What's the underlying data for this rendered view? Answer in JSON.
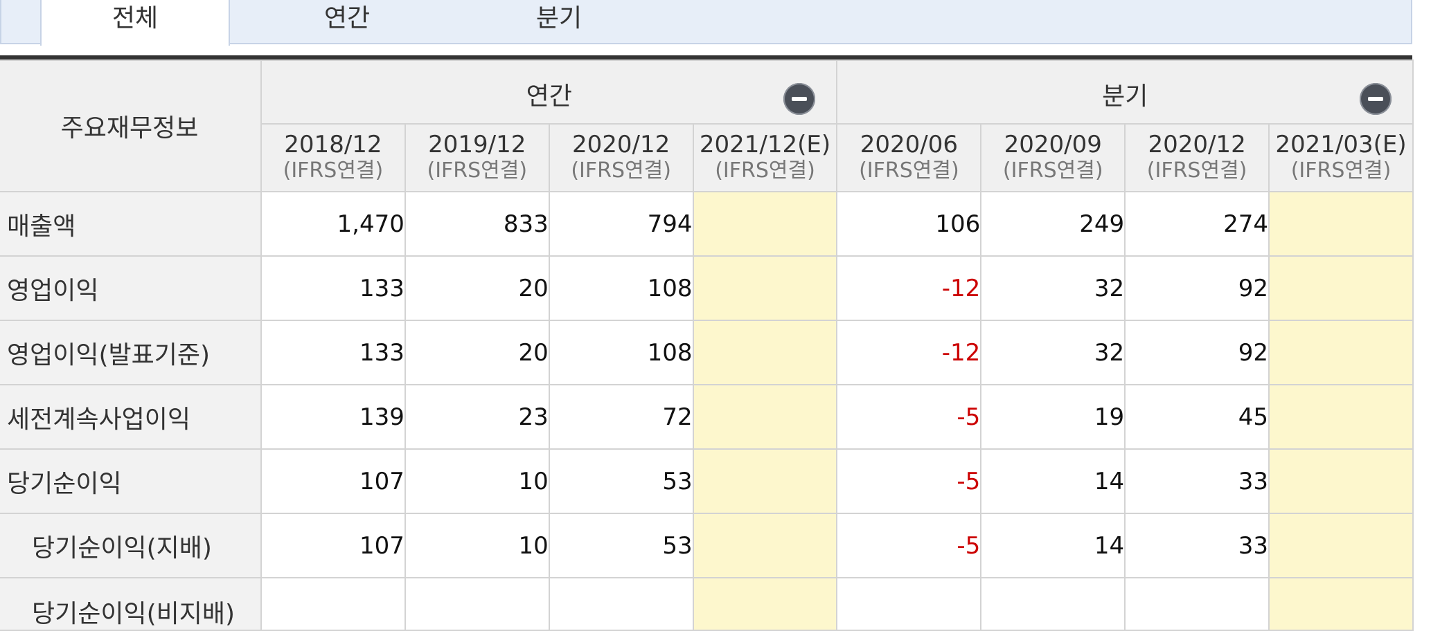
{
  "tabs": {
    "all": "전체",
    "annual": "연간",
    "quarter": "분기"
  },
  "table": {
    "main_header": "주요재무정보",
    "group_annual": "연간",
    "group_quarter": "분기",
    "periods": [
      {
        "date": "2018/12",
        "basis": "(IFRS연결)"
      },
      {
        "date": "2019/12",
        "basis": "(IFRS연결)"
      },
      {
        "date": "2020/12",
        "basis": "(IFRS연결)"
      },
      {
        "date": "2021/12(E)",
        "basis": "(IFRS연결)"
      },
      {
        "date": "2020/06",
        "basis": "(IFRS연결)"
      },
      {
        "date": "2020/09",
        "basis": "(IFRS연결)"
      },
      {
        "date": "2020/12",
        "basis": "(IFRS연결)"
      },
      {
        "date": "2021/03(E)",
        "basis": "(IFRS연결)"
      }
    ],
    "rows": [
      {
        "label": "매출액",
        "values": [
          "1,470",
          "833",
          "794",
          "",
          "106",
          "249",
          "274",
          ""
        ]
      },
      {
        "label": "영업이익",
        "values": [
          "133",
          "20",
          "108",
          "",
          "-12",
          "32",
          "92",
          ""
        ]
      },
      {
        "label": "영업이익(발표기준)",
        "values": [
          "133",
          "20",
          "108",
          "",
          "-12",
          "32",
          "92",
          ""
        ]
      },
      {
        "label": "세전계속사업이익",
        "values": [
          "139",
          "23",
          "72",
          "",
          "-5",
          "19",
          "45",
          ""
        ]
      },
      {
        "label": "당기순이익",
        "values": [
          "107",
          "10",
          "53",
          "",
          "-5",
          "14",
          "33",
          ""
        ]
      },
      {
        "label": "당기순이익(지배)",
        "values": [
          "107",
          "10",
          "53",
          "",
          "-5",
          "14",
          "33",
          ""
        ]
      },
      {
        "label": "당기순이익(비지배)",
        "values": [
          "",
          "",
          "",
          "",
          "",
          "",
          "",
          ""
        ]
      }
    ]
  },
  "colors": {
    "negative": "#cc0000",
    "estimate_bg": "#fdf7cd",
    "header_bg": "#f0f0f0"
  }
}
